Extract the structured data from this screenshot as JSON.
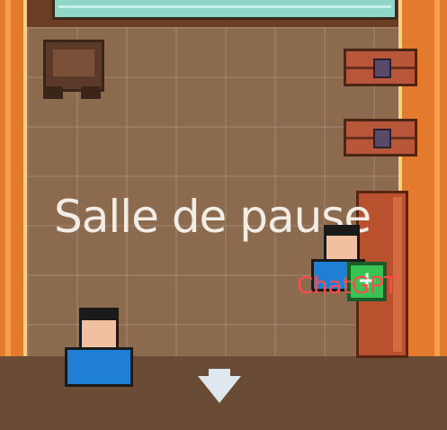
{
  "room": {
    "name": "Salle de pause"
  },
  "npc": {
    "name": "ChatGPT",
    "badge_icon": "gift-icon",
    "badge_glyph": "+"
  },
  "navigation": {
    "exit_icon": "down-arrow-icon"
  },
  "colors": {
    "wall": "#e37a2e",
    "floor": "#8c6a4d",
    "npc_name": "#ff4b4b",
    "badge": "#38c452",
    "shirt": "#1e7fd4"
  }
}
